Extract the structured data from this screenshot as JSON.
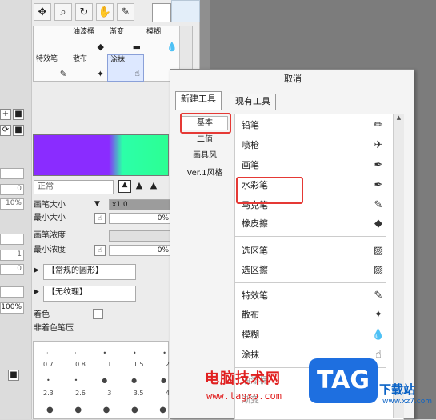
{
  "toolbar": {
    "icons": [
      "move-icon",
      "zoom-icon",
      "rotate-icon",
      "hand-icon",
      "eyedropper-icon"
    ]
  },
  "tool_grid": {
    "row1": [
      "油漆桶",
      "渐变",
      "模糊"
    ],
    "row2": [
      "特效笔",
      "散布",
      "涂抹"
    ]
  },
  "left_fields": [
    "0",
    "10%",
    "0",
    "1",
    "0",
    "100%"
  ],
  "brush": {
    "mode": "正常",
    "size_label": "画笔大小",
    "size_multiplier": "x1.0",
    "min_size_label": "最小大小",
    "min_size_value": "0%",
    "density_label": "画笔浓度",
    "min_density_label": "最小浓度",
    "min_density_value": "0%",
    "shape": "【常规的圆形】",
    "texture": "【无纹理】",
    "color_label": "着色",
    "non_color_label": "非着色笔压",
    "sizes_row1": [
      "0.7",
      "0.8",
      "1",
      "1.5",
      "2"
    ],
    "sizes_row2": [
      "2.3",
      "2.6",
      "3",
      "3.5",
      "4"
    ]
  },
  "menu": {
    "title": "取消",
    "tabs": [
      "新建工具",
      "现有工具"
    ],
    "categories": [
      "基本",
      "二值",
      "画具风",
      "Ver.1风格"
    ],
    "items": [
      "铅笔",
      "喷枪",
      "画笔",
      "水彩笔",
      "马克笔",
      "橡皮擦",
      "选区笔",
      "选区擦",
      "特效笔",
      "散布",
      "模糊",
      "涂抹",
      "油漆桶",
      "渐变"
    ]
  },
  "watermark": {
    "site_name": "电脑技术网",
    "url": "www.tagxp.com",
    "logo": "TAG",
    "download": "下载站",
    "download_url": "www.xz7.com"
  }
}
